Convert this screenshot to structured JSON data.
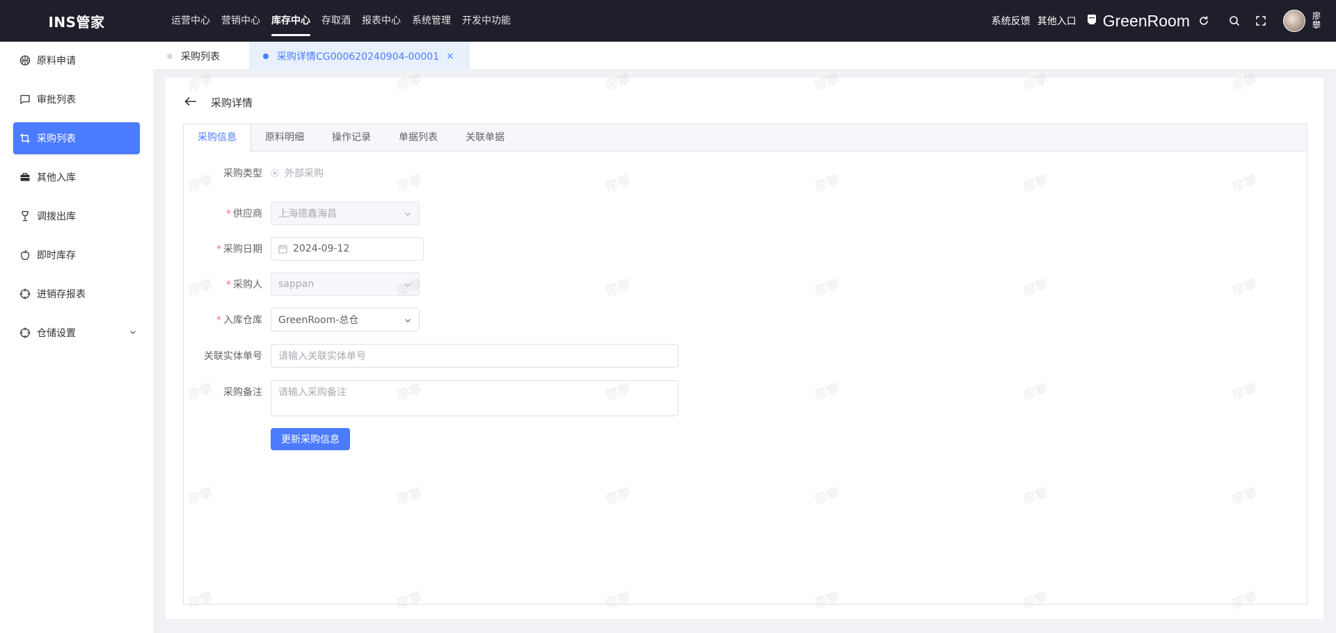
{
  "app": {
    "logo": "INS管家"
  },
  "topnav": [
    {
      "label": "运营中心",
      "active": false
    },
    {
      "label": "营销中心",
      "active": false
    },
    {
      "label": "库存中心",
      "active": true
    },
    {
      "label": "存取酒",
      "active": false
    },
    {
      "label": "报表中心",
      "active": false
    },
    {
      "label": "系统管理",
      "active": false
    },
    {
      "label": "开发中功能",
      "active": false
    }
  ],
  "topright": {
    "feedback": "系统反馈",
    "other_entry": "其他入口",
    "store_name": "GreenRoom",
    "user_name": "廖攀"
  },
  "sidebar": {
    "items": [
      {
        "label": "原料申请",
        "icon": "basketball-icon"
      },
      {
        "label": "审批列表",
        "icon": "chat-icon"
      },
      {
        "label": "采购列表",
        "icon": "crop-icon",
        "active": true
      },
      {
        "label": "其他入库",
        "icon": "briefcase-icon"
      },
      {
        "label": "调拨出库",
        "icon": "goblet-icon"
      },
      {
        "label": "即时库存",
        "icon": "apple-icon"
      },
      {
        "label": "进销存报表",
        "icon": "aim-icon"
      },
      {
        "label": "仓储设置",
        "icon": "aim-icon",
        "expandable": true
      }
    ]
  },
  "page_tabs": [
    {
      "label": "采购列表",
      "active": false
    },
    {
      "label": "采购详情CG000620240904-00001",
      "active": true,
      "close": "×"
    }
  ],
  "detail": {
    "title": "采购详情",
    "tabs": [
      "采购信息",
      "原料明细",
      "操作记录",
      "单据列表",
      "关联单据"
    ],
    "active_tab": "采购信息"
  },
  "form": {
    "purchase_type": {
      "label": "采购类型",
      "value": "外部采购"
    },
    "supplier": {
      "label": "供应商",
      "value": "上海德鑫海昌",
      "required": "*"
    },
    "purchase_date": {
      "label": "采购日期",
      "value": "2024-09-12",
      "required": "*"
    },
    "buyer": {
      "label": "采购人",
      "value": "sappan",
      "required": "*"
    },
    "warehouse": {
      "label": "入库仓库",
      "value": "GreenRoom-总仓",
      "required": "*"
    },
    "entity_no": {
      "label": "关联实体单号",
      "placeholder": "请输入关联实体单号"
    },
    "remark": {
      "label": "采购备注",
      "placeholder": "请输入采购备注"
    },
    "submit": "更新采购信息"
  },
  "watermark_text": "廖攀",
  "colors": {
    "primary": "#4b7bff",
    "topbar": "#1f1f2b",
    "required": "#f56c6c"
  }
}
